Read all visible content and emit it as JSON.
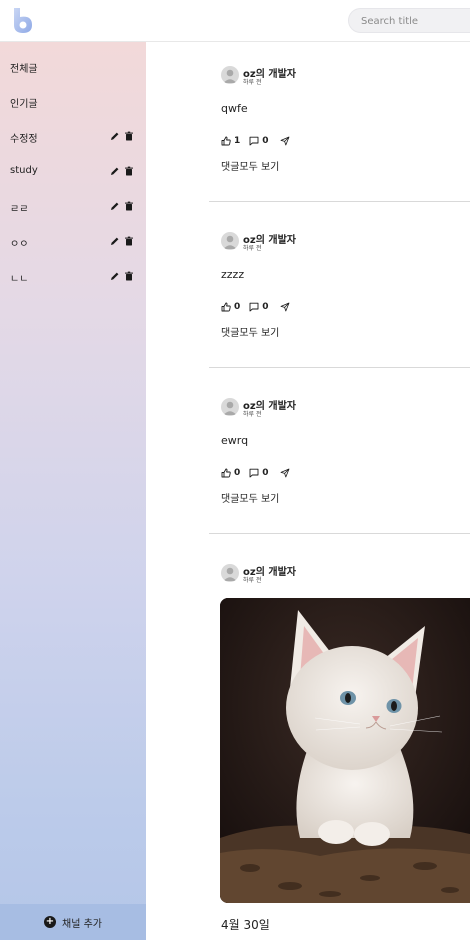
{
  "header": {
    "logo_icon": "blog-logo-icon",
    "search_placeholder": "Search title"
  },
  "sidebar": {
    "items": [
      {
        "label": "전체글",
        "editable": false
      },
      {
        "label": "인기글",
        "editable": false
      },
      {
        "label": "수정정",
        "editable": true
      },
      {
        "label": "study",
        "editable": true
      },
      {
        "label": "ㄹㄹ",
        "editable": true
      },
      {
        "label": "ㅇㅇ",
        "editable": true
      },
      {
        "label": "ㄴㄴ",
        "editable": true
      }
    ],
    "edit_icon": "pencil-icon",
    "delete_icon": "trash-icon",
    "add_channel_label": "채널 추가"
  },
  "posts": [
    {
      "author": "oz의 개발자",
      "time": "하루 전",
      "content": "qwfe",
      "likes": "1",
      "comments": "0",
      "comments_link": "댓글모두 보기"
    },
    {
      "author": "oz의 개발자",
      "time": "하루 전",
      "content": "zzzz",
      "likes": "0",
      "comments": "0",
      "comments_link": "댓글모두 보기"
    },
    {
      "author": "oz의 개발자",
      "time": "하루 전",
      "content": "ewrq",
      "likes": "0",
      "comments": "0",
      "comments_link": "댓글모두 보기"
    },
    {
      "author": "oz의 개발자",
      "time": "하루 전",
      "image": "kitten-photo",
      "date": "4월 30일"
    }
  ],
  "colors": {
    "sidebar_top": "#f2d9d9",
    "sidebar_bottom": "#b4c6e8",
    "add_channel_bg": "#a7bde3"
  }
}
